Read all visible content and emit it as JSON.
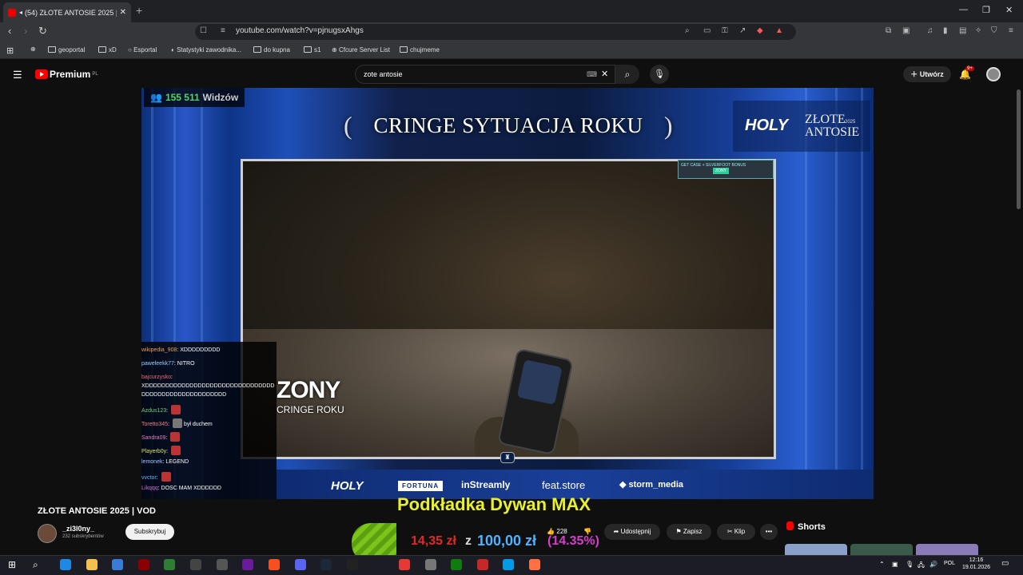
{
  "browser": {
    "tab_title": "(54) ZŁOTE ANTOSIE 2025 | V",
    "url": "youtube.com/watch?v=pjnugsxAhgs",
    "bookmarks": [
      "geoportal",
      "xD",
      "Esportal",
      "Statystyki zawodnika...",
      "do kupna",
      "s1",
      "Cfcure Server List",
      "chujmeme"
    ]
  },
  "youtube": {
    "logo": "Premium",
    "logo_region": "PL",
    "search_query": "zote antosie",
    "create_label": "Utwórz",
    "bell_badge": "9+"
  },
  "stream": {
    "viewers_count": "155 511",
    "viewers_label": "Widzów",
    "category": "CRINGE SYTUACJA ROKU",
    "brand_logo": "HOLY",
    "brand_event": "ZŁOTE ANTOSIE",
    "brand_year": "2025",
    "nominee": "ZONY",
    "nominee_sub": "CRINGE ROKU",
    "overlay_text": "GET CASE + SILVERFOOT BONUS",
    "overlay_btn": "ZONY",
    "sponsors": [
      "HOLY",
      "FORTUNA",
      "inStreamly",
      "feat.store",
      "storm_media"
    ]
  },
  "chat": [
    {
      "user": "wikipedia_908",
      "color": "#f0a050",
      "msg": "XDDDDDDDDD"
    },
    {
      "user": "paweleekk77",
      "color": "#9ad0ff",
      "msg": "NITRO"
    },
    {
      "user": "bajcurzysko",
      "color": "#f07070",
      "msg": ""
    },
    {
      "user": "",
      "color": "#ffffff",
      "msg": "XDDDDDDDDDDDDDDDDDDDDDDDDDDDDDDDD"
    },
    {
      "user": "",
      "color": "#ffffff",
      "msg": "DDDDDDDDDDDDDDDDDDDDD"
    },
    {
      "user": "Azdus123",
      "color": "#7ad07a",
      "msg": ""
    },
    {
      "user": "Toretto345",
      "color": "#f08080",
      "msg": "był duchem"
    },
    {
      "user": "Sandra09",
      "color": "#e080c0",
      "msg": ""
    },
    {
      "user": "Playerb0y",
      "color": "#e0e060",
      "msg": ""
    },
    {
      "user": "lemonek",
      "color": "#a0c8ff",
      "msg": "LEGEND"
    },
    {
      "user": "vvctor",
      "color": "#70b0ff",
      "msg": ""
    },
    {
      "user": "Likqqq",
      "color": "#d070d0",
      "msg": "DOSC MAM XDDDDDD"
    }
  ],
  "video": {
    "title": "ZŁOTE ANTOSIE 2025 | VOD",
    "channel": "_zi3l0ny_",
    "subs": "232 subskrybentów",
    "subscribe": "Subskrybuj",
    "likes": "228",
    "share": "Udostępnij",
    "save": "Zapisz",
    "clip": "Klip",
    "more": "•••"
  },
  "promo": {
    "title": "Podkładka Dywan MAX",
    "current": "14,35 zł",
    "sep": "z",
    "goal": "100,00 zł",
    "pct": "(14.35%)",
    "progress": 0.1435
  },
  "shorts": {
    "label": "Shorts"
  },
  "taskbar": {
    "lang": "POL",
    "time": "12:16",
    "date": "19.01.2026"
  }
}
